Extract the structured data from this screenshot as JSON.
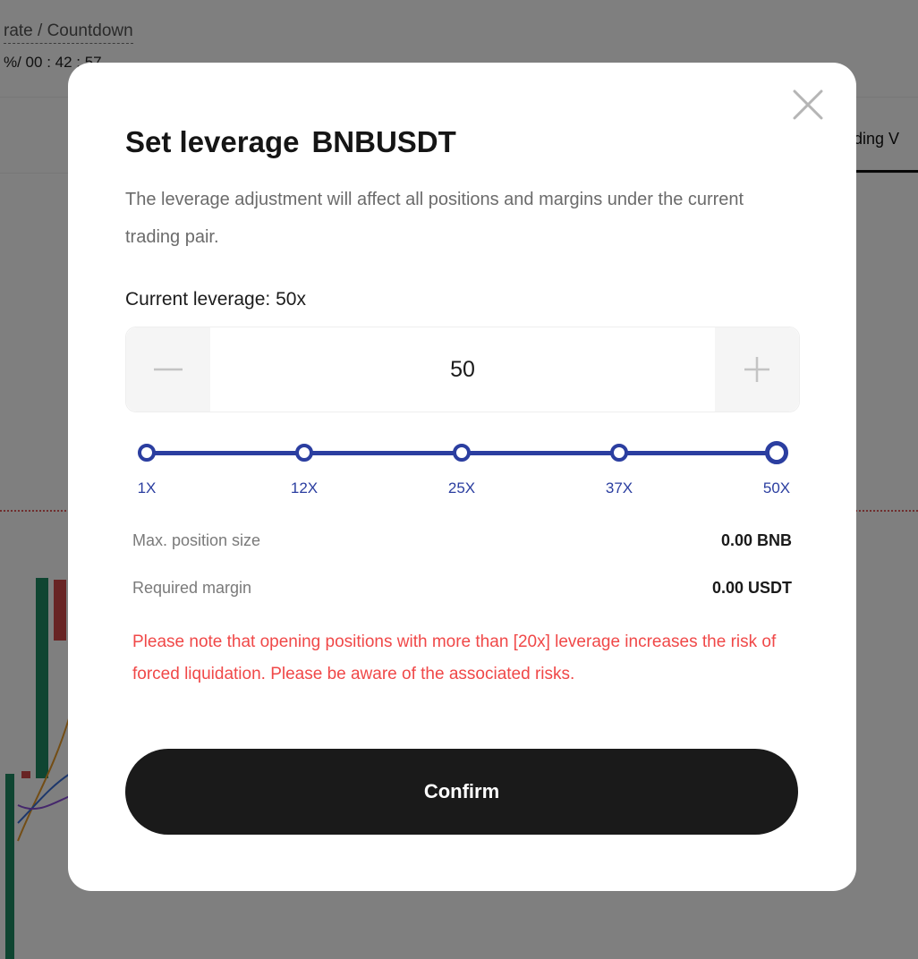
{
  "background": {
    "funding_label": "rate / Countdown",
    "funding_value": "%/ 00 : 42 : 57",
    "tab_partial": "ading V"
  },
  "modal": {
    "title": "Set leverage",
    "symbol": "BNBUSDT",
    "description": "The leverage adjustment will affect all positions and margins under the current trading pair.",
    "current_leverage_label": "Current leverage: 50x",
    "stepper": {
      "value": "50",
      "minus_icon": "minus-icon",
      "plus_icon": "plus-icon"
    },
    "slider": {
      "marks": [
        "1X",
        "12X",
        "25X",
        "37X",
        "50X"
      ],
      "selected": "50X",
      "selected_fraction": 1.0
    },
    "info": {
      "max_position_label": "Max. position size",
      "max_position_value": "0.00 BNB",
      "required_margin_label": "Required margin",
      "required_margin_value": "0.00 USDT"
    },
    "warning": "Please note that opening positions with more than [20x] leverage increases the risk of forced liquidation. Please be aware of the associated risks.",
    "confirm_label": "Confirm",
    "close_icon": "close-icon"
  },
  "colors": {
    "accent": "#2b3ea0",
    "warning": "#f04848",
    "button": "#1a1a1a",
    "overlay": "rgba(0,0,0,0.5)"
  }
}
